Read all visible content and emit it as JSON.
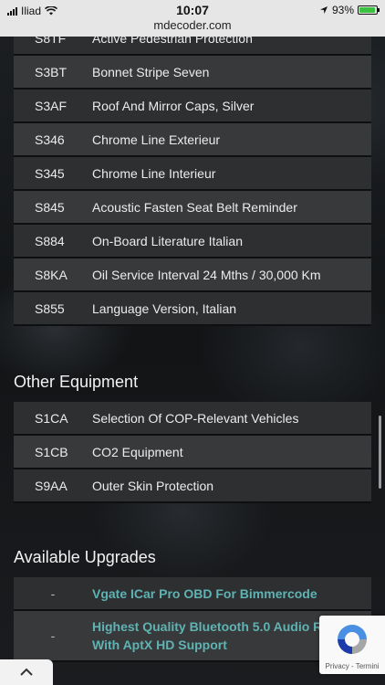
{
  "status_bar": {
    "carrier": "Iliad",
    "time": "10:07",
    "url": "mdecoder.com",
    "battery": "93%",
    "battery_level": 0.93
  },
  "top_rows": [
    {
      "code": "S8TF",
      "desc": "Active Pedestrian Protection"
    },
    {
      "code": "S3BT",
      "desc": "Bonnet Stripe Seven"
    },
    {
      "code": "S3AF",
      "desc": "Roof And Mirror Caps, Silver"
    },
    {
      "code": "S346",
      "desc": "Chrome Line Exterieur"
    },
    {
      "code": "S345",
      "desc": "Chrome Line Interieur"
    },
    {
      "code": "S845",
      "desc": "Acoustic Fasten Seat Belt Reminder"
    },
    {
      "code": "S884",
      "desc": "On-Board Literature Italian"
    },
    {
      "code": "S8KA",
      "desc": "Oil Service Interval 24 Mths / 30,000 Km"
    },
    {
      "code": "S855",
      "desc": "Language Version, Italian"
    }
  ],
  "other_equipment": {
    "title": "Other Equipment",
    "rows": [
      {
        "code": "S1CA",
        "desc": "Selection Of COP-Relevant Vehicles"
      },
      {
        "code": "S1CB",
        "desc": "CO2 Equipment"
      },
      {
        "code": "S9AA",
        "desc": "Outer Skin Protection"
      }
    ]
  },
  "available_upgrades": {
    "title": "Available Upgrades",
    "rows": [
      {
        "code": "-",
        "desc": "Vgate ICar Pro OBD For Bimmercode"
      },
      {
        "code": "-",
        "desc": "Highest Quality Bluetooth 5.0 Audio Re… With AptX HD Support"
      }
    ]
  },
  "recaptcha": {
    "terms": "Privacy - Termini"
  },
  "colors": {
    "link": "#5fb3b3",
    "row_dark": "#2d2f31",
    "row_light": "#38393b"
  }
}
